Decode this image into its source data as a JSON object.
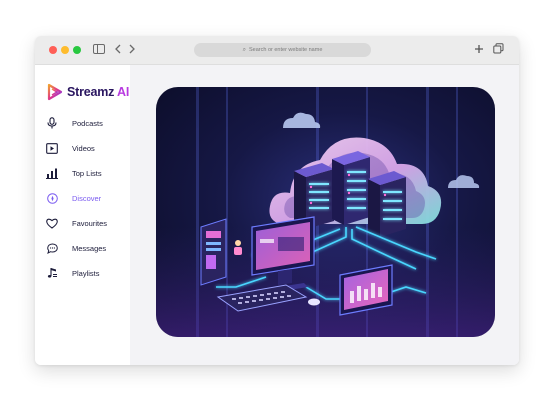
{
  "browser": {
    "url_placeholder": "Search or enter website name",
    "icons": {
      "sidebar_toggle": "sidebar-toggle-icon",
      "back": "chevron-left-icon",
      "forward": "chevron-right-icon",
      "new_tab": "plus-icon",
      "tabs": "tabs-overview-icon"
    }
  },
  "app": {
    "brand_name": "Streamz",
    "brand_suffix": "AI",
    "colors": {
      "brand": "#2a1660",
      "accent": "#b83ae0",
      "active": "#7b5cf0"
    }
  },
  "sidebar": {
    "items": [
      {
        "label": "Podcasts",
        "icon": "microphone-icon",
        "active": false
      },
      {
        "label": "Videos",
        "icon": "video-play-icon",
        "active": false
      },
      {
        "label": "Top Lists",
        "icon": "bar-chart-icon",
        "active": false
      },
      {
        "label": "Discover",
        "icon": "compass-icon",
        "active": true
      },
      {
        "label": "Favourites",
        "icon": "heart-icon",
        "active": false
      },
      {
        "label": "Messages",
        "icon": "chat-bubble-icon",
        "active": false
      },
      {
        "label": "Playlists",
        "icon": "music-note-icon",
        "active": false
      }
    ]
  },
  "main": {
    "hero_image": "cloud-server-network-illustration"
  }
}
